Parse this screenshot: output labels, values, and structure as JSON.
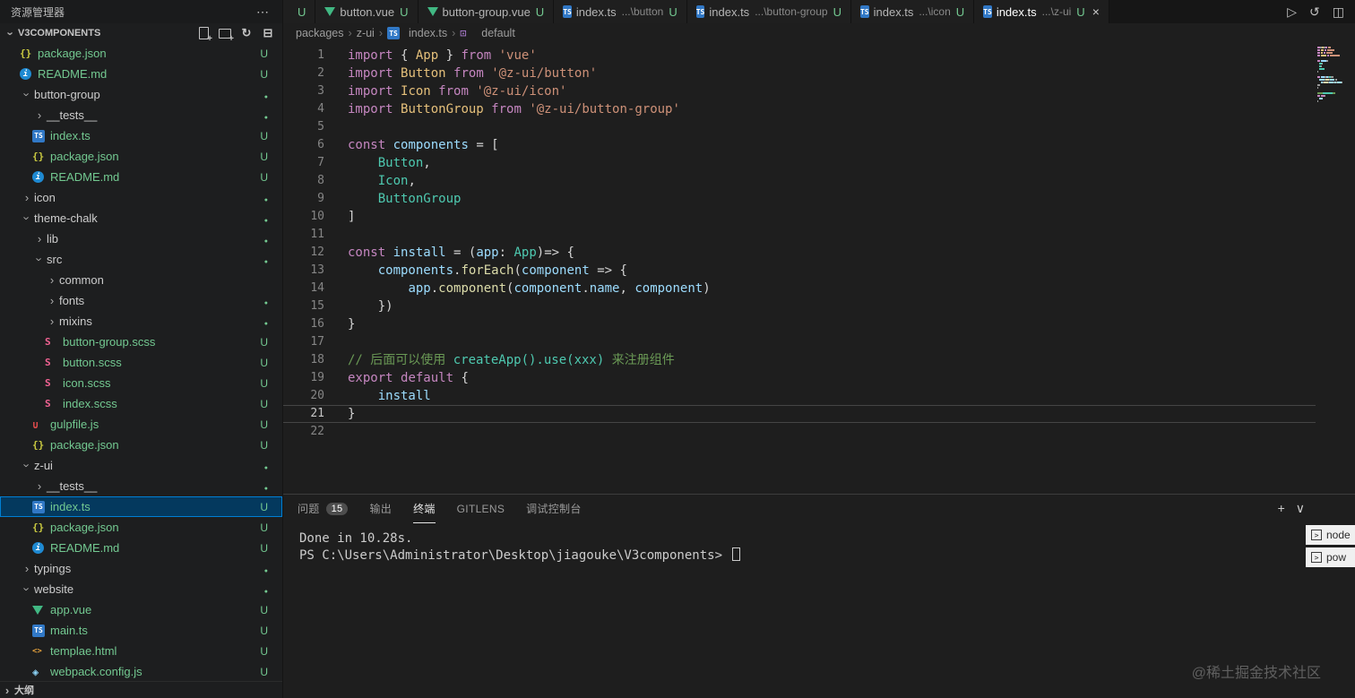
{
  "colors": {
    "accent": "#007fd4",
    "selection_bg": "#04395e",
    "git_untracked": "#73c991",
    "editor_bg": "#1e1e1e",
    "active_tab_bg": "#1e1e1e"
  },
  "watermark": "@稀土掘金技术社区",
  "explorer": {
    "title": "资源管理器",
    "section": "V3COMPONENTS",
    "actions": [
      "new-file",
      "new-folder",
      "refresh",
      "collapse-all"
    ],
    "outline_label": "大纲",
    "tree": [
      {
        "i": 1,
        "icon": "json",
        "label": "package.json",
        "badge": "U"
      },
      {
        "i": 1,
        "icon": "info",
        "label": "README.md",
        "badge": "U"
      },
      {
        "i": 1,
        "chev": "down",
        "label": "button-group",
        "dot": true
      },
      {
        "i": 2,
        "chev": "right",
        "label": "__tests__",
        "dot": true
      },
      {
        "i": 2,
        "icon": "ts",
        "label": "index.ts",
        "badge": "U"
      },
      {
        "i": 2,
        "icon": "json",
        "label": "package.json",
        "badge": "U"
      },
      {
        "i": 2,
        "icon": "info",
        "label": "README.md",
        "badge": "U"
      },
      {
        "i": 1,
        "chev": "right",
        "label": "icon",
        "dot": true
      },
      {
        "i": 1,
        "chev": "down",
        "label": "theme-chalk",
        "dot": true
      },
      {
        "i": 2,
        "chev": "right",
        "label": "lib",
        "dot": true
      },
      {
        "i": 2,
        "chev": "down",
        "label": "src",
        "dot": true
      },
      {
        "i": 3,
        "chev": "right",
        "label": "common"
      },
      {
        "i": 3,
        "chev": "right",
        "label": "fonts",
        "dot": true
      },
      {
        "i": 3,
        "chev": "right",
        "label": "mixins",
        "dot": true
      },
      {
        "i": 3,
        "icon": "scss",
        "label": "button-group.scss",
        "badge": "U"
      },
      {
        "i": 3,
        "icon": "scss",
        "label": "button.scss",
        "badge": "U"
      },
      {
        "i": 3,
        "icon": "scss",
        "label": "icon.scss",
        "badge": "U"
      },
      {
        "i": 3,
        "icon": "scss",
        "label": "index.scss",
        "badge": "U"
      },
      {
        "i": 2,
        "icon": "gulp",
        "label": "gulpfile.js",
        "badge": "U"
      },
      {
        "i": 2,
        "icon": "json",
        "label": "package.json",
        "badge": "U"
      },
      {
        "i": 1,
        "chev": "down",
        "label": "z-ui",
        "dot": true
      },
      {
        "i": 2,
        "chev": "right",
        "label": "__tests__",
        "dot": true
      },
      {
        "i": 2,
        "icon": "ts",
        "label": "index.ts",
        "badge": "U",
        "selected": true
      },
      {
        "i": 2,
        "icon": "json",
        "label": "package.json",
        "badge": "U"
      },
      {
        "i": 2,
        "icon": "info",
        "label": "README.md",
        "badge": "U"
      },
      {
        "i": 1,
        "chev": "right",
        "label": "typings",
        "dot": true
      },
      {
        "i": 1,
        "chev": "down",
        "label": "website",
        "dot": true
      },
      {
        "i": 2,
        "icon": "vue",
        "label": "app.vue",
        "badge": "U"
      },
      {
        "i": 2,
        "icon": "ts",
        "label": "main.ts",
        "badge": "U"
      },
      {
        "i": 2,
        "icon": "html",
        "label": "templae.html",
        "badge": "U"
      },
      {
        "i": 2,
        "icon": "webpack",
        "label": "webpack.config.js",
        "badge": "U"
      }
    ]
  },
  "tabs": [
    {
      "label": "",
      "dirty": "U",
      "partial": true
    },
    {
      "icon": "vue",
      "label": "button.vue",
      "dirty": "U"
    },
    {
      "icon": "vue",
      "label": "button-group.vue",
      "dirty": "U"
    },
    {
      "icon": "ts",
      "label": "index.ts",
      "desc": "...\\button",
      "dirty": "U"
    },
    {
      "icon": "ts",
      "label": "index.ts",
      "desc": "...\\button-group",
      "dirty": "U"
    },
    {
      "icon": "ts",
      "label": "index.ts",
      "desc": "...\\icon",
      "dirty": "U"
    },
    {
      "icon": "ts",
      "label": "index.ts",
      "desc": "...\\z-ui",
      "dirty": "U",
      "active": true
    }
  ],
  "editor_actions": [
    {
      "name": "run-button",
      "glyph": "▷"
    },
    {
      "name": "history-button",
      "glyph": "↺"
    },
    {
      "name": "split-editor-button",
      "glyph": "◫"
    }
  ],
  "editor": {
    "breadcrumb": [
      {
        "label": "packages"
      },
      {
        "label": "z-ui"
      },
      {
        "label": "index.ts",
        "icon": "ts"
      },
      {
        "label": "default",
        "icon": "symbol"
      }
    ],
    "active_line": 21,
    "lines": [
      [
        [
          "import",
          "kw"
        ],
        [
          " { ",
          "pun"
        ],
        [
          "App",
          "cls"
        ],
        [
          " } ",
          "pun"
        ],
        [
          "from",
          "kw"
        ],
        [
          " ",
          "pun"
        ],
        [
          "'vue'",
          "str"
        ]
      ],
      [
        [
          "import",
          "kw"
        ],
        [
          " ",
          "pun"
        ],
        [
          "Button",
          "cls"
        ],
        [
          " ",
          "pun"
        ],
        [
          "from",
          "kw"
        ],
        [
          " ",
          "pun"
        ],
        [
          "'@z-ui/button'",
          "str"
        ]
      ],
      [
        [
          "import",
          "kw"
        ],
        [
          " ",
          "pun"
        ],
        [
          "Icon",
          "cls"
        ],
        [
          " ",
          "pun"
        ],
        [
          "from",
          "kw"
        ],
        [
          " ",
          "pun"
        ],
        [
          "'@z-ui/icon'",
          "str"
        ]
      ],
      [
        [
          "import",
          "kw"
        ],
        [
          " ",
          "pun"
        ],
        [
          "ButtonGroup",
          "cls"
        ],
        [
          " ",
          "pun"
        ],
        [
          "from",
          "kw"
        ],
        [
          " ",
          "pun"
        ],
        [
          "'@z-ui/button-group'",
          "str"
        ]
      ],
      [],
      [
        [
          "const",
          "kw"
        ],
        [
          " ",
          "pun"
        ],
        [
          "components",
          "var"
        ],
        [
          " = [",
          "pun"
        ]
      ],
      [
        [
          "    ",
          "pun"
        ],
        [
          "Button",
          "type"
        ],
        [
          ",",
          "pun"
        ]
      ],
      [
        [
          "    ",
          "pun"
        ],
        [
          "Icon",
          "type"
        ],
        [
          ",",
          "pun"
        ]
      ],
      [
        [
          "    ",
          "pun"
        ],
        [
          "ButtonGroup",
          "type"
        ]
      ],
      [
        [
          "]",
          "pun"
        ]
      ],
      [],
      [
        [
          "const",
          "kw"
        ],
        [
          " ",
          "pun"
        ],
        [
          "install",
          "var"
        ],
        [
          " = (",
          "pun"
        ],
        [
          "app",
          "var"
        ],
        [
          ": ",
          "pun"
        ],
        [
          "App",
          "type"
        ],
        [
          ")",
          "pun"
        ],
        [
          "=>",
          "pun"
        ],
        [
          " {",
          "pun"
        ]
      ],
      [
        [
          "    ",
          "pun"
        ],
        [
          "components",
          "var"
        ],
        [
          ".",
          "pun"
        ],
        [
          "forEach",
          "fn"
        ],
        [
          "(",
          "pun"
        ],
        [
          "component",
          "var"
        ],
        [
          " ",
          "pun"
        ],
        [
          "=>",
          "pun"
        ],
        [
          " {",
          "pun"
        ]
      ],
      [
        [
          "        ",
          "pun"
        ],
        [
          "app",
          "var"
        ],
        [
          ".",
          "pun"
        ],
        [
          "component",
          "fn"
        ],
        [
          "(",
          "pun"
        ],
        [
          "component",
          "var"
        ],
        [
          ".",
          "pun"
        ],
        [
          "name",
          "var"
        ],
        [
          ", ",
          "pun"
        ],
        [
          "component",
          "var"
        ],
        [
          ")",
          "pun"
        ]
      ],
      [
        [
          "    })",
          "pun"
        ]
      ],
      [
        [
          "}",
          "pun"
        ]
      ],
      [],
      [
        [
          "// 后面可以使用 ",
          "com"
        ],
        [
          "createApp().use(xxx)",
          "comc"
        ],
        [
          " 来注册组件",
          "com"
        ]
      ],
      [
        [
          "export",
          "kw"
        ],
        [
          " ",
          "pun"
        ],
        [
          "default",
          "kw"
        ],
        [
          " {",
          "pun"
        ]
      ],
      [
        [
          "    ",
          "pun"
        ],
        [
          "install",
          "var"
        ]
      ],
      [
        [
          "}",
          "pun"
        ]
      ],
      []
    ]
  },
  "panel": {
    "tabs": [
      {
        "label": "问题",
        "badge": "15"
      },
      {
        "label": "输出"
      },
      {
        "label": "终端",
        "active": true
      },
      {
        "label": "GITLENS"
      },
      {
        "label": "调试控制台"
      }
    ],
    "actions": [
      {
        "name": "new-terminal-button",
        "glyph": "+"
      },
      {
        "name": "terminal-dropdown-button",
        "glyph": "∨"
      }
    ],
    "terminal_lines": [
      "Done in 10.28s.",
      "PS C:\\Users\\Administrator\\Desktop\\jiagouke\\V3components> "
    ],
    "instances": [
      {
        "label": "node"
      },
      {
        "label": "pow"
      }
    ]
  }
}
